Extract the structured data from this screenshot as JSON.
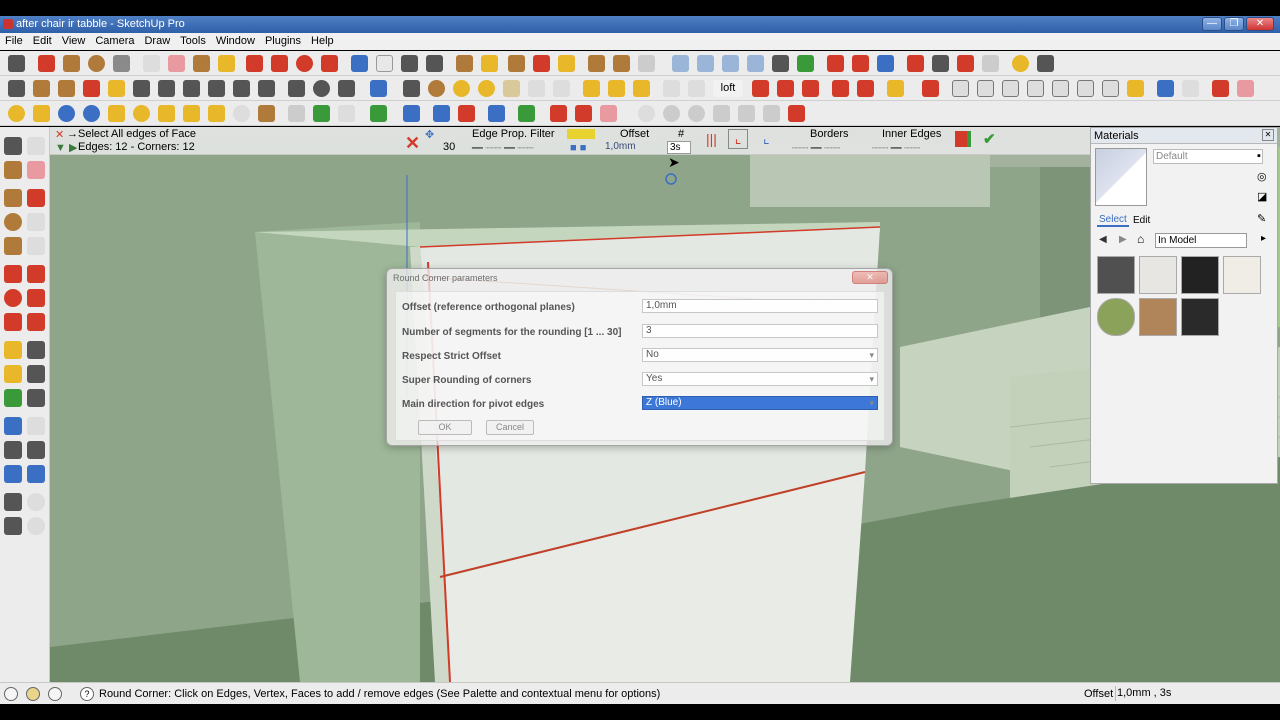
{
  "window": {
    "title": "after chair ir tabble - SketchUp Pro",
    "minimize": "—",
    "maximize": "❐",
    "close": "✕"
  },
  "menu": [
    "File",
    "Edit",
    "View",
    "Camera",
    "Draw",
    "Tools",
    "Window",
    "Plugins",
    "Help"
  ],
  "toolbar": {
    "loft_label": "loft",
    "colors": {
      "red": "#d23a2a",
      "blue": "#3a6fc4",
      "green": "#3a9a3a",
      "yellow": "#e8b82a",
      "gray": "#8a8a8a",
      "brown": "#b07a3a"
    }
  },
  "vcb": {
    "line1": "Select All edges of Face",
    "line2": "Edges: 12 - Corners: 12",
    "segments_small": "30",
    "edge_filter_label": "Edge Prop. Filter",
    "offset_label": "Offset",
    "offset_value": "1,0mm",
    "hash_label": "#",
    "hash_value": "3s",
    "borders_label": "Borders",
    "inner_edges_label": "Inner Edges"
  },
  "dialog": {
    "title": "Round Corner parameters",
    "fields": [
      {
        "label": "Offset (reference orthogonal planes)",
        "value": "1,0mm",
        "type": "text"
      },
      {
        "label": "Number of segments for the rounding   [1 ... 30]",
        "value": "3",
        "type": "text"
      },
      {
        "label": "Respect Strict Offset",
        "value": "No",
        "type": "select"
      },
      {
        "label": "Super Rounding of corners",
        "value": "Yes",
        "type": "select"
      },
      {
        "label": "Main direction for pivot edges",
        "value": "Z (Blue)",
        "type": "select"
      }
    ],
    "ok": "OK",
    "cancel": "Cancel"
  },
  "materials": {
    "title": "Materials",
    "default_name": "Default",
    "tab_select": "Select",
    "tab_edit": "Edit",
    "library": "In Model"
  },
  "status": {
    "message": "Round Corner: Click on Edges, Vertex, Faces to add / remove edges (See Palette and contextual menu for options)",
    "measure_label": "Offset",
    "measure_value": "1,0mm , 3s"
  }
}
